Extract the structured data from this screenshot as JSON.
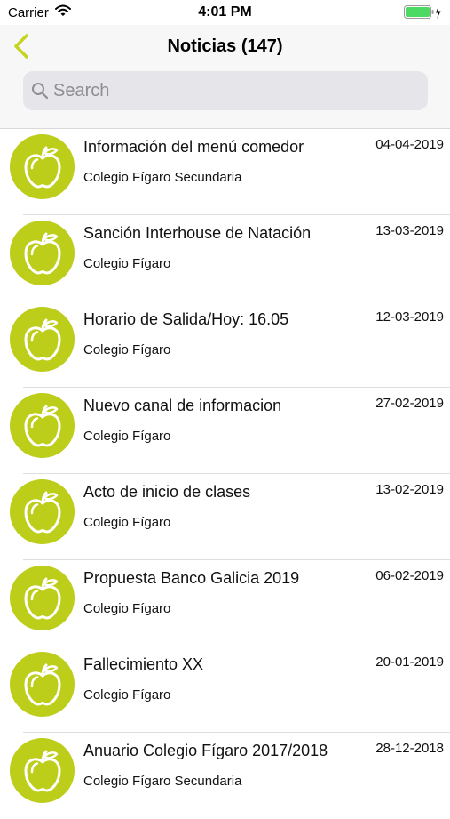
{
  "status_bar": {
    "carrier": "Carrier",
    "time": "4:01 PM"
  },
  "nav": {
    "title": "Noticias (147)"
  },
  "search": {
    "placeholder": "Search",
    "value": ""
  },
  "colors": {
    "accent": "#bccd1a",
    "back_chevron": "#c5d41f"
  },
  "news": [
    {
      "title": "Información del menú comedor",
      "subtitle": "Colegio Fígaro Secundaria",
      "date": "04-04-2019",
      "icon": "apple-icon"
    },
    {
      "title": "Sanción Interhouse de Natación",
      "subtitle": "Colegio Fígaro",
      "date": "13-03-2019",
      "icon": "apple-icon"
    },
    {
      "title": "Horario de Salida/Hoy: 16.05",
      "subtitle": "Colegio Fígaro",
      "date": "12-03-2019",
      "icon": "apple-icon"
    },
    {
      "title": "Nuevo canal de informacion",
      "subtitle": "Colegio Fígaro",
      "date": "27-02-2019",
      "icon": "apple-icon"
    },
    {
      "title": "Acto de inicio de clases",
      "subtitle": "Colegio Fígaro",
      "date": "13-02-2019",
      "icon": "apple-icon"
    },
    {
      "title": "Propuesta Banco Galicia 2019",
      "subtitle": "Colegio Fígaro",
      "date": "06-02-2019",
      "icon": "apple-icon"
    },
    {
      "title": "Fallecimiento XX",
      "subtitle": "Colegio Fígaro",
      "date": "20-01-2019",
      "icon": "apple-icon"
    },
    {
      "title": "Anuario Colegio Fígaro 2017/2018",
      "subtitle": "Colegio Fígaro Secundaria",
      "date": "28-12-2018",
      "icon": "apple-icon"
    }
  ]
}
